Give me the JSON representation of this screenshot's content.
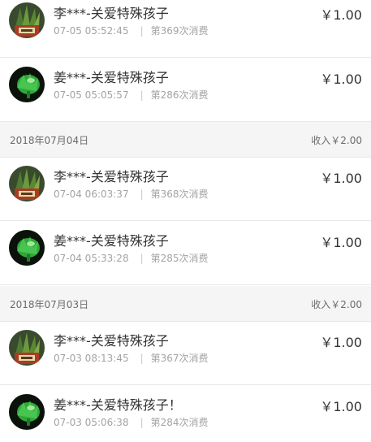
{
  "records": [
    {
      "avatar": "plant-pot-avatar",
      "name": "李***",
      "purpose": "-关爱特殊孩子",
      "time": "07-05 05:52:45",
      "sep": "|",
      "count": "第369次消费",
      "amount": "￥1.00"
    },
    {
      "avatar": "green-orb-avatar",
      "name": "姜***",
      "purpose": "-关爱特殊孩子",
      "time": "07-05 05:05:57",
      "sep": "|",
      "count": "第286次消费",
      "amount": "￥1.00"
    },
    {
      "avatar": "plant-pot-avatar",
      "name": "李***",
      "purpose": "-关爱特殊孩子",
      "time": "07-04 06:03:37",
      "sep": "|",
      "count": "第368次消费",
      "amount": "￥1.00"
    },
    {
      "avatar": "green-orb-avatar",
      "name": "姜***",
      "purpose": "-关爱特殊孩子",
      "time": "07-04 05:33:28",
      "sep": "|",
      "count": "第285次消费",
      "amount": "￥1.00"
    },
    {
      "avatar": "plant-pot-avatar",
      "name": "李***",
      "purpose": "-关爱特殊孩子",
      "time": "07-03 08:13:45",
      "sep": "|",
      "count": "第367次消费",
      "amount": "￥1.00"
    },
    {
      "avatar": "green-orb-avatar",
      "name": "姜***",
      "purpose": "-关爱特殊孩子！",
      "time": "07-03 05:06:38",
      "sep": "|",
      "count": "第284次消费",
      "amount": "￥1.00"
    }
  ],
  "date_headers": [
    {
      "date": "2018年07月04日",
      "income": "收入￥2.00"
    },
    {
      "date": "2018年07月03日",
      "income": "收入￥2.00"
    }
  ],
  "colors": {
    "text": "#333333",
    "meta": "#a3a3a3",
    "header_bg": "#f5f5f5"
  }
}
